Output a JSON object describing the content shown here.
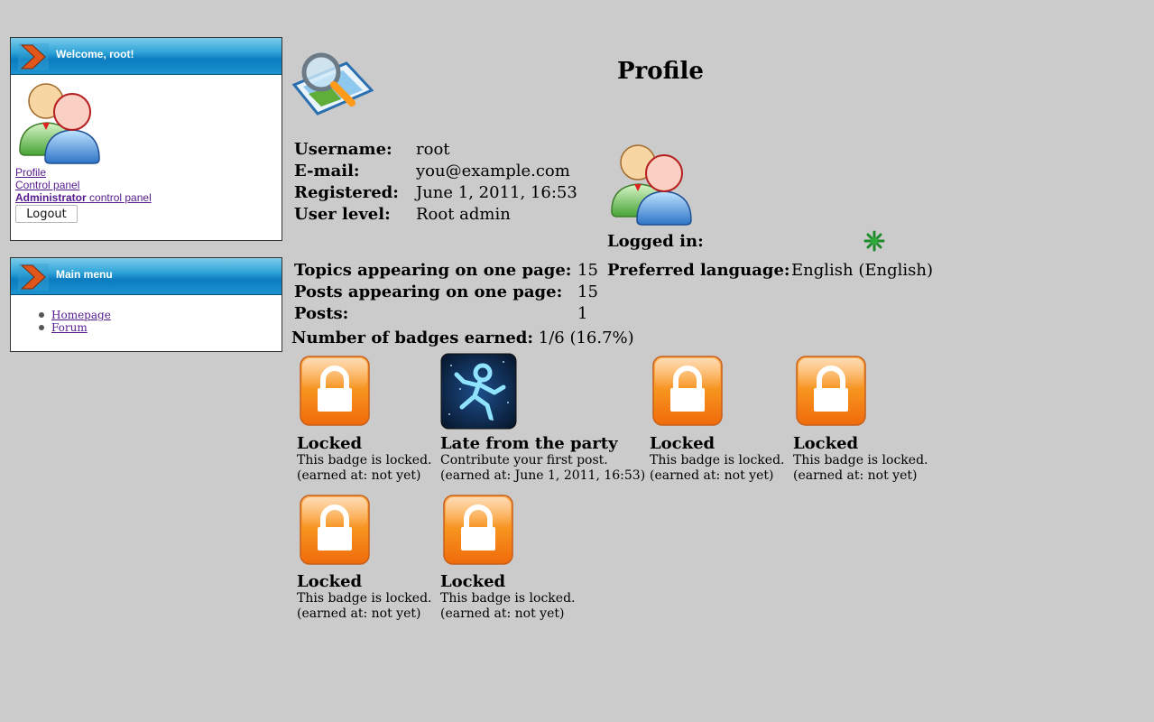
{
  "sidebar": {
    "user_box": {
      "title": "Welcome, root!",
      "links": {
        "profile": "Profile",
        "control_panel": "Control panel",
        "admin_bold": "Administrator",
        "admin_rest": " control panel"
      },
      "logout_label": "Logout"
    },
    "menu_box": {
      "title": "Main menu",
      "items": [
        "Homepage",
        "Forum"
      ]
    }
  },
  "profile": {
    "title": "Profile",
    "fields": {
      "username_label": "Username:",
      "username": "root",
      "email_label": "E-mail:",
      "email": "you@example.com",
      "registered_label": "Registered:",
      "registered": "June 1, 2011, 16:53",
      "level_label": "User level:",
      "level": "Root admin",
      "logged_in_label": "Logged in:",
      "topics_label": "Topics appearing on one page:",
      "topics": "15",
      "posts_page_label": "Posts appearing on one page:",
      "posts_page": "15",
      "posts_label": "Posts:",
      "posts": "1",
      "language_label": "Preferred language:",
      "language": "English (English)"
    },
    "badges_summary_label": "Number of badges earned:",
    "badges_summary_value": "1/6 (16.7%)",
    "badges": [
      {
        "title": "Locked",
        "desc": "This badge is locked.",
        "earned": "(earned at: not yet)",
        "icon": "lock-icon"
      },
      {
        "title": "Late from the party",
        "desc": "Contribute your first post.",
        "earned": "(earned at: June 1, 2011, 16:53)",
        "icon": "astronaut-icon"
      },
      {
        "title": "Locked",
        "desc": "This badge is locked.",
        "earned": "(earned at: not yet)",
        "icon": "lock-icon"
      },
      {
        "title": "Locked",
        "desc": "This badge is locked.",
        "earned": "(earned at: not yet)",
        "icon": "lock-icon"
      },
      {
        "title": "Locked",
        "desc": "This badge is locked.",
        "earned": "(earned at: not yet)",
        "icon": "lock-icon"
      },
      {
        "title": "Locked",
        "desc": "This badge is locked.",
        "earned": "(earned at: not yet)",
        "icon": "lock-icon"
      }
    ]
  },
  "colors": {
    "background": "#cbcbcb",
    "header_blue": "#0a7cbf",
    "lock_orange": "#f7931e",
    "link": "#551a8b",
    "online_green": "#1f8a2a"
  }
}
